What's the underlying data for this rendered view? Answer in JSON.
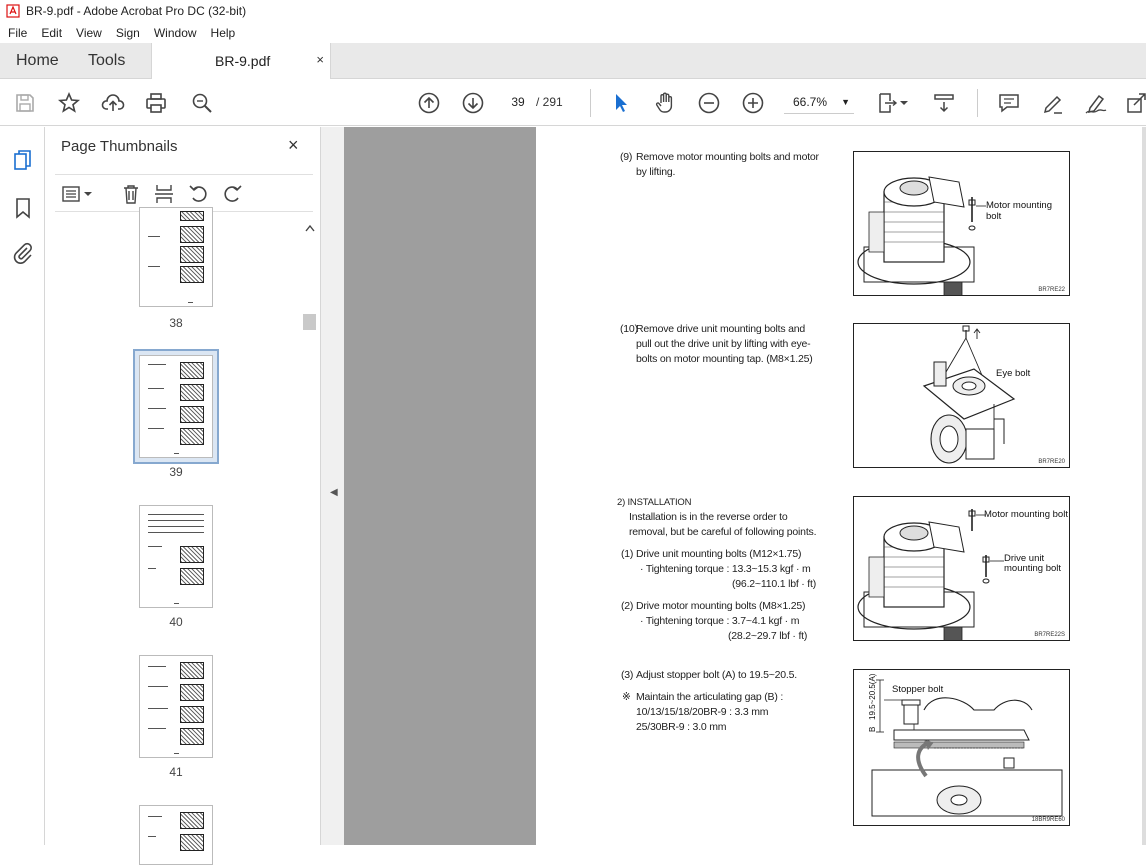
{
  "window": {
    "title": "BR-9.pdf - Adobe Acrobat Pro DC (32-bit)"
  },
  "menu": [
    "File",
    "Edit",
    "View",
    "Sign",
    "Window",
    "Help"
  ],
  "tabs": {
    "home": "Home",
    "tools": "Tools",
    "document": "BR-9.pdf",
    "close": "×"
  },
  "toolbar": {
    "current_page": "39",
    "page_total": "/ 291",
    "zoom": "66.7%"
  },
  "thumbnail_panel": {
    "title": "Page Thumbnails",
    "close": "×",
    "pages": [
      "38",
      "39",
      "40",
      "41"
    ],
    "selected_page": "39"
  },
  "document": {
    "steps": [
      {
        "num": "(9)",
        "lines": [
          "Remove motor mounting bolts and motor",
          "by lifting."
        ]
      },
      {
        "num": "(10)",
        "lines": [
          "Remove drive unit mounting bolts and",
          "pull out the drive unit by lifting with eye-",
          "bolts on motor mounting tap. (M8×1.25)"
        ]
      }
    ],
    "installation": {
      "heading": "2)  INSTALLATION",
      "intro": [
        "Installation is in the reverse order to",
        "removal, but be careful of following points."
      ],
      "items": [
        {
          "num": "(1)",
          "title": "Drive unit mounting bolts (M12×1.75)",
          "torque": "· Tightening torque : 13.3~15.3 kgf · m",
          "torque2": "(96.2~110.1 lbf · ft)"
        },
        {
          "num": "(2)",
          "title": "Drive motor mounting bolts (M8×1.25)",
          "torque": "· Tightening torque : 3.7~4.1 kgf · m",
          "torque2": "(28.2~29.7 lbf · ft)"
        }
      ],
      "step3": {
        "num": "(3)",
        "text": "Adjust stopper bolt (A) to 19.5~20.5."
      },
      "note": {
        "mark": "※",
        "lines": [
          "Maintain the articulating gap (B) :",
          "10/13/15/18/20BR-9 : 3.3 mm",
          "25/30BR-9 : 3.0 mm"
        ]
      }
    },
    "figures": [
      {
        "labels": [
          "Motor mounting bolt"
        ],
        "code": "BR7RE22"
      },
      {
        "labels": [
          "Eye bolt"
        ],
        "code": "BR7RE20"
      },
      {
        "labels": [
          "Motor mounting bolt",
          "Drive unit",
          "mounting bolt"
        ],
        "code": "BR7RE22S"
      },
      {
        "labels": [
          "Stopper bolt",
          "B",
          "19.5~20.5(A)"
        ],
        "code": "18BR9RE60"
      }
    ]
  }
}
